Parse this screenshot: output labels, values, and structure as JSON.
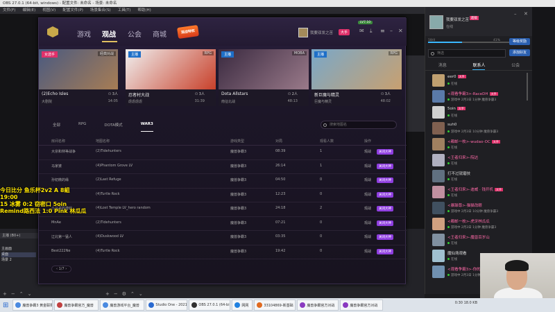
{
  "obs": {
    "title": "OBS 27.0.1 (64-bit, windows) - 配置文件: 未命名 - 场景: 未命名",
    "menu": [
      "文件(F)",
      "编辑(E)",
      "视图(V)",
      "配置文件(P)",
      "场景集合(S)",
      "工具(T)",
      "帮助(H)"
    ],
    "dock_title": "主播 (B0+)",
    "dock_items": [
      "主画面",
      "桌面",
      "场景 2"
    ]
  },
  "overlay": {
    "lines": [
      "今日比分 鱼乐杯2v2 A 8組",
      "19:00",
      "15 冰雾 0:2 窃密口 5oin",
      "Remind路西法 1:0 Pink 林瓜瓜"
    ]
  },
  "game": {
    "tabs": [
      "游戏",
      "观战",
      "公会",
      "商城"
    ],
    "promo": "观战特权",
    "user": {
      "name": "我要双发之苦",
      "badge": "大手",
      "level": "LV7.10"
    },
    "cards": [
      {
        "tag": "女选手",
        "genre": "经典对战",
        "title": "(2)Echo Isles",
        "sub": "大剧院",
        "count": "3人",
        "time": "14:05",
        "color1": "#4a5a80",
        "color2": "#b08050",
        "tagColor": "red"
      },
      {
        "tag": "主播",
        "genre": "RPG",
        "title": "忍者村大战",
        "sub": "虐虐虐虐",
        "count": "3人",
        "time": "31:39",
        "color1": "#f0f0f0",
        "color2": "#c8402a",
        "tagColor": "blue"
      },
      {
        "tag": "主播",
        "genre": "MOBA",
        "title": "Dota Allstars",
        "sub": "南征北战",
        "count": "2人",
        "time": "48:13",
        "color1": "#3a2a40",
        "color2": "#9a7a8a",
        "tagColor": "blue"
      },
      {
        "tag": "主播",
        "genre": "RPG",
        "title": "新巨魔与精灵",
        "sub": "巨魔与精灵",
        "count": "3人",
        "time": "48:02",
        "color1": "#7aa8c8",
        "color2": "#c8a070",
        "tagColor": "blue"
      }
    ],
    "filters": [
      "全部",
      "RPG",
      "DOTA模式",
      "WAR3"
    ],
    "search_placeholder": "搜索地图名",
    "columns": [
      "房间名称",
      "地图名称",
      "游戏类型",
      "对局",
      "观看人数",
      "操作"
    ],
    "rows": [
      {
        "room": "大宗和林等战争",
        "map": "(2)Tidehunters",
        "type": "魔兽争霸3",
        "time": "08:39",
        "viewers": "1",
        "op": "观战"
      },
      {
        "room": "马家婆",
        "map": "(4)Phantom Grove LV",
        "type": "魔兽争霸3",
        "time": "26:14",
        "viewers": "1",
        "op": "观战"
      },
      {
        "room": "孙初微的缘",
        "map": "(2)Last Refuge",
        "type": "魔兽争霸3",
        "time": "04:50",
        "viewers": "0",
        "op": "观战"
      },
      {
        "room": "",
        "map": "(4)Turtle Rock",
        "type": "魔兽争霸3",
        "time": "12:23",
        "viewers": "0",
        "op": "观战"
      },
      {
        "room": "小马哥的游戏",
        "map": "(4)Lost Temple LV_hero random",
        "type": "魔兽争霸3",
        "time": "24:18",
        "viewers": "2",
        "op": "观战"
      },
      {
        "room": "MnAe",
        "map": "(2)Tidehunters",
        "type": "魔兽争霸3",
        "time": "07:21",
        "viewers": "0",
        "op": "观战"
      },
      {
        "room": "辽北第一猛人",
        "map": "(4)Duskwood LV",
        "type": "魔兽争霸3",
        "time": "03:35",
        "viewers": "0",
        "op": "观战"
      },
      {
        "room": "Best222Ne",
        "map": "(4)Turtle Rock",
        "type": "魔兽争霸3",
        "time": "19:42",
        "viewers": "0",
        "op": "观战"
      }
    ],
    "join_label": "关闭大神",
    "pager": "1/7"
  },
  "side": {
    "user_name": "我要双发之苦",
    "vip": "超级",
    "status": "在线",
    "bar_label": "18/4",
    "bar_pct": "41%",
    "bar_fill": 0.41,
    "btn1": "等级奖励",
    "btn2": "添加好友",
    "search_placeholder": "筛选",
    "tabs": [
      "消息",
      "联系人",
      "公会"
    ],
    "contacts": [
      {
        "name": "eer0",
        "badge": "大手",
        "status": "在线",
        "pink": false,
        "c": "#c0a070"
      },
      {
        "name": "<观看争霸3>-RaceDH",
        "badge": "大手",
        "status": "游戏中 2月3日 1分钟 魔兽争霸3",
        "pink": true,
        "c": "#5a7aa8"
      },
      {
        "name": "5oin",
        "badge": "大手",
        "status": "在线",
        "pink": false,
        "c": "#d0d0d0"
      },
      {
        "name": "suh0",
        "badge": "",
        "status": "游戏中 2月3日 10分钟 魔兽争霸3",
        "pink": false,
        "c": "#806050"
      },
      {
        "name": "<都邮一枚>-wudao-OC",
        "badge": "大手",
        "status": "在线",
        "pink": true,
        "c": "#a08060"
      },
      {
        "name": "<王者归来>-院达",
        "badge": "",
        "status": "在线",
        "pink": true,
        "c": "#b0b0c0"
      },
      {
        "name": "打不过就磨技",
        "badge": "",
        "status": "在线",
        "pink": false,
        "c": "#607080"
      },
      {
        "name": "<王者归来>-迪威 · 钱开机",
        "badge": "大手",
        "status": "在线",
        "pink": true,
        "c": "#c090a0"
      },
      {
        "name": "<暴躁尊>-猫猫改眼",
        "badge": "",
        "status": "游戏中 2月3日 10分钟 魔兽争霸3",
        "pink": true,
        "c": "#405060"
      },
      {
        "name": "<都邮一枚>-虎牙林瓜瓜",
        "badge": "",
        "status": "游戏中 2月3日 1分钟 魔兽争霸3",
        "pink": true,
        "c": "#d0a080"
      },
      {
        "name": "<王者归来>-魔兽百岁山",
        "badge": "",
        "status": "在线",
        "pink": true,
        "c": "#8090a0"
      },
      {
        "name": "魔仙场观看",
        "badge": "",
        "status": "在线",
        "pink": false,
        "c": "#a0c0d0"
      },
      {
        "name": "<观看争霸3>-你的",
        "badge": "",
        "status": "游戏中 2月3日 1分钟 魔兽争霸3",
        "pink": true,
        "c": "#7090b0"
      }
    ]
  },
  "taskbar": {
    "items": [
      {
        "label": "魔兽争霸3 黄金联赛",
        "c": "#4a8ae0"
      },
      {
        "label": "魔兽争霸官方_魔兽",
        "c": "#c04040"
      },
      {
        "label": "魔兽游戏平台_魔兽",
        "c": "#4a8ae0"
      },
      {
        "label": "Studio One - 2021",
        "c": "#2a6ad0"
      },
      {
        "label": "OBS 27.0.1 (64-bi",
        "c": "#303030"
      },
      {
        "label": "网网",
        "c": "#2080e0"
      },
      {
        "label": "33104869-新基础",
        "c": "#e06a20"
      },
      {
        "label": "魔兽争霸官方对战",
        "c": "#8a3ac0"
      },
      {
        "label": "魔兽争霸官方对战",
        "c": "#8a3ac0"
      }
    ],
    "time": "0:30  18.0 KB"
  }
}
